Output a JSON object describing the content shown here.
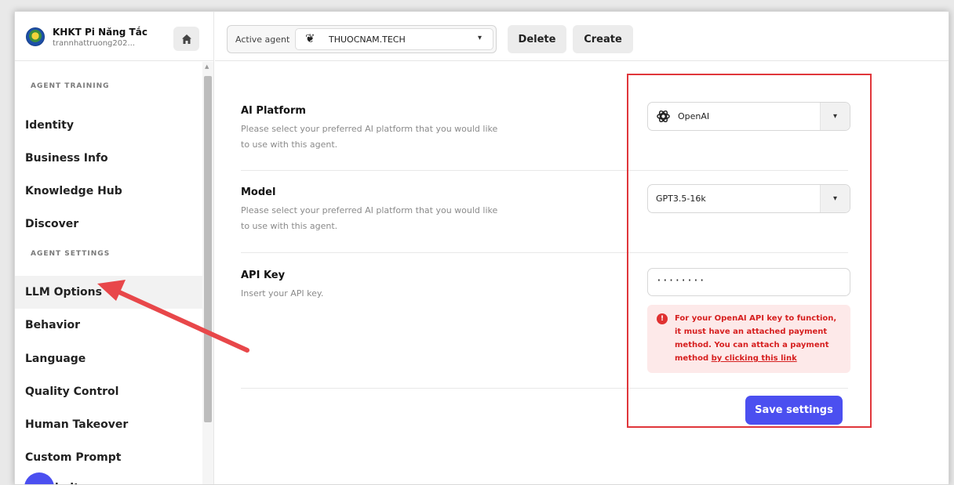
{
  "workspace": {
    "name": "KHKT Pi Năng Tắc",
    "email": "trannhattruong202..."
  },
  "sidebar": {
    "sections": [
      {
        "label": "AGENT TRAINING"
      },
      {
        "label": "AGENT SETTINGS"
      }
    ],
    "items": [
      {
        "label": "Identity"
      },
      {
        "label": "Business Info"
      },
      {
        "label": "Knowledge Hub"
      },
      {
        "label": "Discover"
      },
      {
        "label": "LLM Options"
      },
      {
        "label": "Behavior"
      },
      {
        "label": "Language"
      },
      {
        "label": "Quality Control"
      },
      {
        "label": "Human Takeover"
      },
      {
        "label": "Custom Prompt"
      },
      {
        "label": "Limits"
      }
    ]
  },
  "topbar": {
    "agent_label": "Active agent",
    "agent_name": "THUOCNAM.TECH",
    "delete_label": "Delete",
    "create_label": "Create"
  },
  "settings": {
    "platform": {
      "title": "AI Platform",
      "description": "Please select your preferred AI platform that you would like to use with this agent.",
      "value": "OpenAI"
    },
    "model": {
      "title": "Model",
      "description": "Please select your preferred AI platform that you would like to use with this agent.",
      "value": "GPT3.5-16k"
    },
    "api_key": {
      "title": "API Key",
      "description": "Insert your API key.",
      "value": "········"
    },
    "warning": {
      "text": "For your OpenAI API key to function, it must have an attached payment method. You can attach a payment method ",
      "link": "by clicking this link"
    },
    "save_label": "Save settings"
  },
  "colors": {
    "accent": "#4b4ff0",
    "warning_bg": "#fde9e9",
    "warning_text": "#d61f1f",
    "annotation": "#e0363b"
  }
}
